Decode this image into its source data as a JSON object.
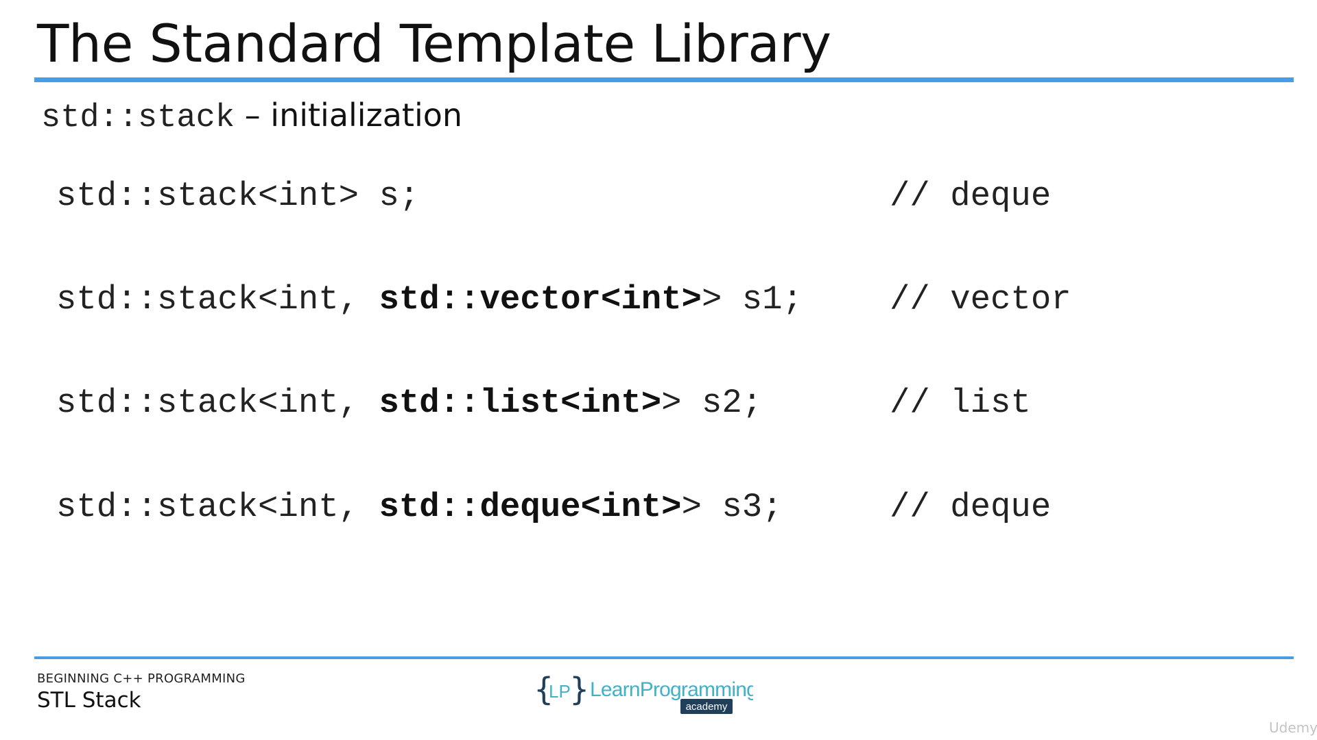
{
  "slide": {
    "title": "The Standard Template Library"
  },
  "subtitle": {
    "code": "std::stack",
    "text": " – initialization"
  },
  "code_lines": [
    {
      "plain_before": "std::stack<int> s;",
      "bold": "",
      "plain_after": "",
      "comment": "// deque"
    },
    {
      "plain_before": "std::stack<int, ",
      "bold": "std::vector<int>",
      "plain_after": "> s1;",
      "comment": "// vector"
    },
    {
      "plain_before": "std::stack<int, ",
      "bold": "std::list<int>",
      "plain_after": "> s2;",
      "comment": "// list"
    },
    {
      "plain_before": "std::stack<int, ",
      "bold": "std::deque<int>",
      "plain_after": "> s3;",
      "comment": "// deque"
    }
  ],
  "footer": {
    "course": "BEGINNING C++ PROGRAMMING",
    "lesson": "STL Stack",
    "logo_brace_text": "LP",
    "logo_main_text": "LearnProgramming",
    "logo_sub_text": "academy",
    "watermark": "Udemy"
  },
  "colors": {
    "accent_rule": "#4a9de2",
    "logo_teal": "#3fb2c9",
    "logo_dark": "#1f3f5b"
  }
}
